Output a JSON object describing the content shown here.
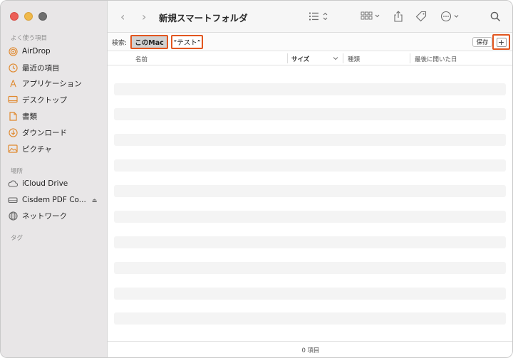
{
  "window": {
    "title": "新規スマートフォルダ"
  },
  "sidebar": {
    "favorites_label": "よく使う項目",
    "favorites": [
      {
        "label": "AirDrop",
        "icon": "airdrop-icon"
      },
      {
        "label": "最近の項目",
        "icon": "clock-icon"
      },
      {
        "label": "アプリケーション",
        "icon": "applications-icon"
      },
      {
        "label": "デスクトップ",
        "icon": "desktop-icon"
      },
      {
        "label": "書類",
        "icon": "document-icon"
      },
      {
        "label": "ダウンロード",
        "icon": "download-icon"
      },
      {
        "label": "ピクチャ",
        "icon": "pictures-icon"
      }
    ],
    "locations_label": "場所",
    "locations": [
      {
        "label": "iCloud Drive",
        "icon": "cloud-icon"
      },
      {
        "label": "Cisdem PDF Co...",
        "icon": "disk-icon",
        "eject": "⏏"
      },
      {
        "label": "ネットワーク",
        "icon": "network-icon"
      }
    ],
    "tags_label": "タグ"
  },
  "toolbar": {
    "back": "‹",
    "forward": "›"
  },
  "search": {
    "label": "検索:",
    "scope_mac": "このMac",
    "scope_query": "“テスト”",
    "save_label": "保存",
    "add_label": "+"
  },
  "columns": {
    "name": "名前",
    "size": "サイズ",
    "kind": "種類",
    "last_opened": "最後に開いた日"
  },
  "status": {
    "item_count": "0 項目"
  },
  "colors": {
    "accent_highlight": "#e2561f",
    "sidebar_icon": "#e0892e"
  }
}
